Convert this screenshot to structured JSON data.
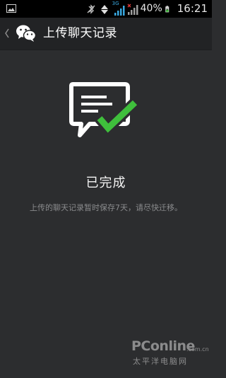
{
  "status_bar": {
    "network_label": "3G",
    "battery_text": "40%",
    "time": "16:21"
  },
  "title_bar": {
    "title": "上传聊天记录"
  },
  "main": {
    "done_title": "已完成",
    "done_subtitle": "上传的聊天记录暂时保存7天，请尽快迁移。"
  },
  "watermark": {
    "brand": "PConline",
    "domain": ".com.cn",
    "brand_cn": "太平洋电脑网"
  },
  "colors": {
    "background": "#2c2d2f",
    "title_bar": "#222325",
    "status_bar": "#000000",
    "check_green": "#3fbf3c",
    "signal_accent": "#39a8e0"
  },
  "icons": {
    "status_left": "gallery-icon",
    "bluetooth": "bluetooth-off-icon",
    "data": "data-transfer-icon",
    "signal_1": "signal-icon",
    "signal_2": "signal-no-service-icon",
    "battery": "battery-charging-icon",
    "back": "chevron-left-icon",
    "logo": "wechat-logo-icon",
    "done": "chat-check-icon"
  }
}
